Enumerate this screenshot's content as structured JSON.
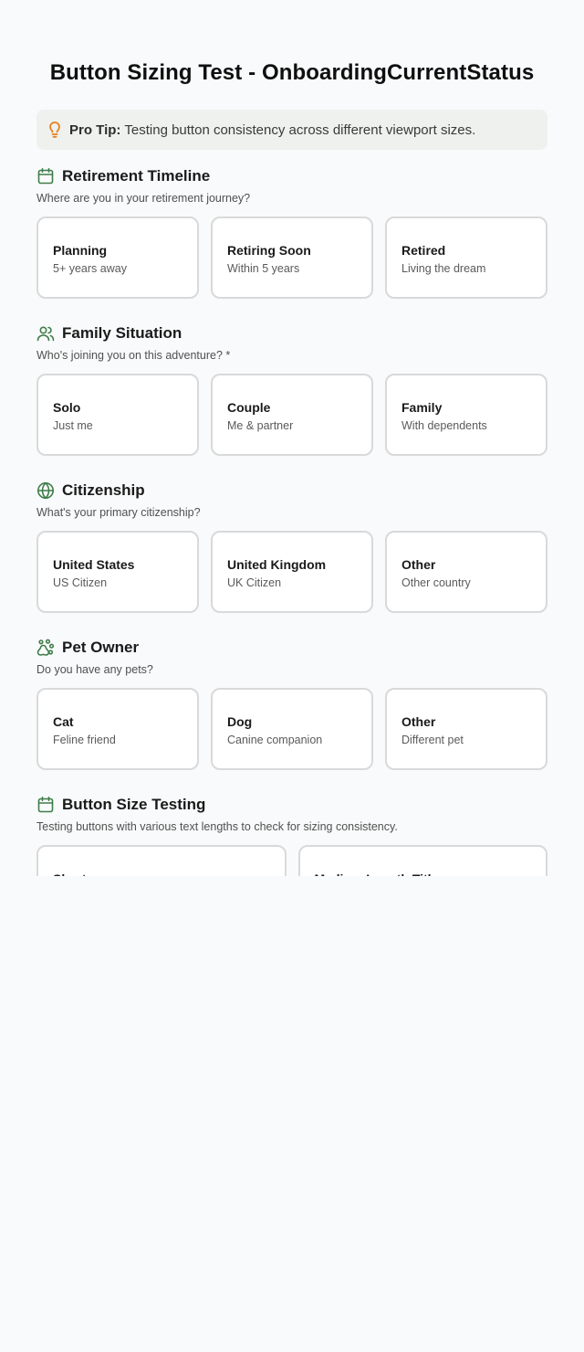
{
  "page_title": "Button Sizing Test - OnboardingCurrentStatus",
  "tip": {
    "label": "Pro Tip:",
    "text": "Testing button consistency across different viewport sizes."
  },
  "colors": {
    "accent_green": "#3f7d4a",
    "tip_orange": "#e8801f",
    "tip_background": "#eef1ee",
    "card_border": "#d9d9d9",
    "page_background": "#f9fafb"
  },
  "sections": [
    {
      "icon": "calendar-icon",
      "title": "Retirement Timeline",
      "subtitle": "Where are you in your retirement journey?",
      "options": [
        {
          "title": "Planning",
          "desc": "5+ years away"
        },
        {
          "title": "Retiring Soon",
          "desc": "Within 5 years"
        },
        {
          "title": "Retired",
          "desc": "Living the dream"
        }
      ]
    },
    {
      "icon": "users-icon",
      "title": "Family Situation",
      "subtitle": "Who's joining you on this adventure? *",
      "options": [
        {
          "title": "Solo",
          "desc": "Just me"
        },
        {
          "title": "Couple",
          "desc": "Me & partner"
        },
        {
          "title": "Family",
          "desc": "With dependents"
        }
      ]
    },
    {
      "icon": "globe-icon",
      "title": "Citizenship",
      "subtitle": "What's your primary citizenship?",
      "options": [
        {
          "title": "United States",
          "desc": "US Citizen"
        },
        {
          "title": "United Kingdom",
          "desc": "UK Citizen"
        },
        {
          "title": "Other",
          "desc": "Other country"
        }
      ]
    },
    {
      "icon": "paw-icon",
      "title": "Pet Owner",
      "subtitle": "Do you have any pets?",
      "options": [
        {
          "title": "Cat",
          "desc": "Feline friend"
        },
        {
          "title": "Dog",
          "desc": "Canine companion"
        },
        {
          "title": "Other",
          "desc": "Different pet"
        }
      ]
    },
    {
      "icon": "calendar-icon",
      "title": "Button Size Testing",
      "subtitle": "Testing buttons with various text lengths to check for sizing consistency.",
      "options": [
        {
          "title": "Short",
          "desc": ""
        },
        {
          "title": "Medium Length Title",
          "desc": ""
        }
      ]
    }
  ]
}
